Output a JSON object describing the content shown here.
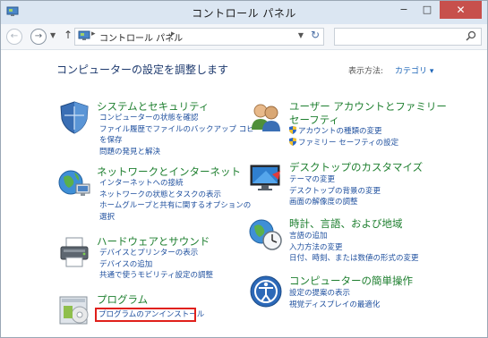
{
  "window": {
    "title": "コントロール パネル",
    "minimize": "−",
    "maximize": "□",
    "close": "✕"
  },
  "nav": {
    "back": "←",
    "forward": "→",
    "up": "↑",
    "breadcrumb": "コントロール パネル",
    "search_placeholder": ""
  },
  "main": {
    "heading": "コンピューターの設定を調整します",
    "view_by_label": "表示方法:",
    "view_by_value": "カテゴリ ▾"
  },
  "categories": [
    {
      "title": "システムとセキュリティ",
      "icon": "shield-icon",
      "links": [
        "コンピューターの状態を確認",
        "ファイル履歴でファイルのバックアップ コピー",
        "を保存",
        "問題の発見と解決"
      ]
    },
    {
      "title": "ネットワークとインターネット",
      "icon": "network-globe-icon",
      "links": [
        "インターネットへの接続",
        "ネットワークの状態とタスクの表示",
        "ホームグループと共有に関するオプションの",
        "選択"
      ]
    },
    {
      "title": "ハードウェアとサウンド",
      "icon": "printer-icon",
      "links": [
        "デバイスとプリンターの表示",
        "デバイスの追加",
        "共通で使うモビリティ設定の調整"
      ]
    },
    {
      "title": "プログラム",
      "icon": "programs-icon",
      "links": [
        "プログラムのアンインストール"
      ]
    },
    {
      "title_line1": "ユーザー アカウントとファミリー",
      "title_line2": "セーフティ",
      "icon": "users-icon",
      "links": [
        "アカウントの種類の変更",
        "ファミリー セーフティの設定"
      ]
    },
    {
      "title": "デスクトップのカスタマイズ",
      "icon": "desktop-monitor-icon",
      "links": [
        "テーマの変更",
        "デスクトップの背景の変更",
        "画面の解像度の調整"
      ]
    },
    {
      "title": "時計、言語、および地域",
      "icon": "clock-globe-icon",
      "links": [
        "言語の追加",
        "入力方法の変更",
        "日付、時刻、または数値の形式の変更"
      ]
    },
    {
      "title": "コンピューターの簡単操作",
      "icon": "ease-of-access-icon",
      "links": [
        "設定の提案の表示",
        "視覚ディスプレイの最適化"
      ]
    }
  ],
  "colors": {
    "category_title": "#1e7f2f",
    "link": "#1e4f9e",
    "highlight_border": "#e0201b",
    "close_button": "#c7504c"
  }
}
